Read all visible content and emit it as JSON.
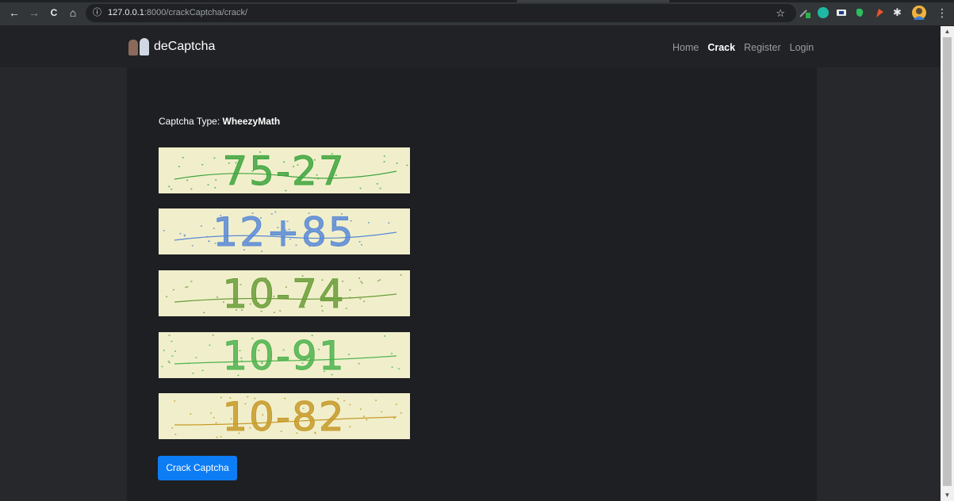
{
  "browser": {
    "url_host": "127.0.0.1",
    "url_rest": ":8000/crackCaptcha/crack/",
    "back_icon": "←",
    "forward_icon": "→",
    "reload_icon": "C",
    "home_icon": "⌂",
    "info_icon": "ⓘ",
    "star_icon": "☆",
    "menu_icon": "⋮"
  },
  "site": {
    "brand_name": "deCaptcha",
    "nav": [
      {
        "label": "Home",
        "active": false
      },
      {
        "label": "Crack",
        "active": true
      },
      {
        "label": "Register",
        "active": false
      },
      {
        "label": "Login",
        "active": false
      }
    ]
  },
  "main": {
    "captcha_type_label": "Captcha Type:",
    "captcha_type_value": "WheezyMath",
    "captchas": [
      {
        "text": "75-27",
        "color": "#3fa53f"
      },
      {
        "text": "12+85",
        "color": "#5a8ad6"
      },
      {
        "text": "10-74",
        "color": "#6a9e3a"
      },
      {
        "text": "10-91",
        "color": "#4fb34f"
      },
      {
        "text": "10-82",
        "color": "#c79a2a"
      }
    ],
    "crack_button_label": "Crack Captcha"
  },
  "colors": {
    "accent": "#0d7df5",
    "captcha_background": "#f1efcb"
  }
}
